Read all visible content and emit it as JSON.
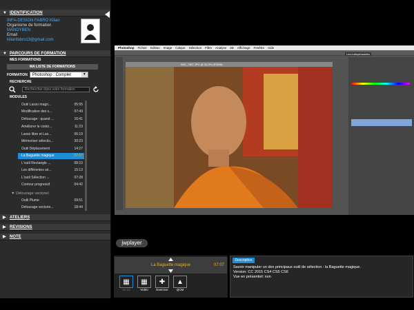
{
  "sidebar": {
    "identification_label": "IDENTIFICATION",
    "identity": {
      "company": "INFA-DESIGN FABRO Kilian",
      "org_label": "Organisme de formation",
      "org_name": "MANDYBEN",
      "email_label": "Email",
      "email": "kilianfabro13@gmail.com"
    },
    "parcours_label": "PARCOURS DE FORMATION",
    "mes_formations_label": "MES FORMATIONS",
    "liste_formations_label": "MA LISTE DE FORMATIONS",
    "formation_label": "FORMATION",
    "formation_value": "Photoshop : Complet",
    "recherche_label": "RECHERCHE",
    "search_placeholder": "Rechercher dans votre formation",
    "modules_label": "MODULES",
    "modules": [
      {
        "title": "Outil Lasso magn...",
        "duration": "05:55"
      },
      {
        "title": "Modification des s...",
        "duration": "07:49"
      },
      {
        "title": "Détourage : quand ...",
        "duration": "16:41"
      },
      {
        "title": "Améliorer le conto...",
        "duration": "11:23"
      },
      {
        "title": "Lasso libre et Las...",
        "duration": "06:19"
      },
      {
        "title": "Mémoriser sélectio...",
        "duration": "20:23"
      },
      {
        "title": "Outil Déplacement",
        "duration": "14:27"
      },
      {
        "title": "La Baguette magique",
        "duration": "07:07"
      },
      {
        "title": "L'outil Rectangle ...",
        "duration": "08:10"
      },
      {
        "title": "Les différentes sé...",
        "duration": "15:13"
      },
      {
        "title": "L'outil Sélection ...",
        "duration": "07:28"
      },
      {
        "title": "Contour progressif",
        "duration": "04:42"
      }
    ],
    "group_label": "Détourage vectoriel",
    "group_items": [
      {
        "title": "Outil Plume",
        "duration": "09:51"
      },
      {
        "title": "Détourage vectorie...",
        "duration": "18:44"
      }
    ],
    "ateliers_label": "ATELIERS",
    "revisions_label": "REVISIONS",
    "note_label": "NOTE"
  },
  "photoshop": {
    "menus": [
      "Photoshop",
      "Fichier",
      "Edition",
      "Image",
      "Calque",
      "Sélection",
      "Filtre",
      "Analyse",
      "3D",
      "Affichage",
      "Fenêtre",
      "Aide"
    ],
    "doc_tab": "IMG_7487.JPG @ 33,3% (RVB/8)",
    "workspace": "Les indispensables"
  },
  "player": {
    "logo": "jwplayer",
    "now_playing": "La Baguette magique",
    "time": "07:07",
    "tools": [
      {
        "icon": "film-icon",
        "label": "02:22"
      },
      {
        "icon": "video-icon",
        "label": "Vidéo"
      },
      {
        "icon": "puzzle-icon",
        "label": "Exercice"
      },
      {
        "icon": "qcm-icon",
        "label": "QCM"
      }
    ]
  },
  "description": {
    "tab_label": "Description",
    "line1": "Savoir manipuler un des principaux outil de sélection : la Baguette magique.",
    "line2": "Version: CC 2015 CS4 CS5 CS6",
    "line3": "Vue en présentiel: non"
  },
  "colors": {
    "accent": "#1e8fd6",
    "highlight": "#f4b400"
  }
}
